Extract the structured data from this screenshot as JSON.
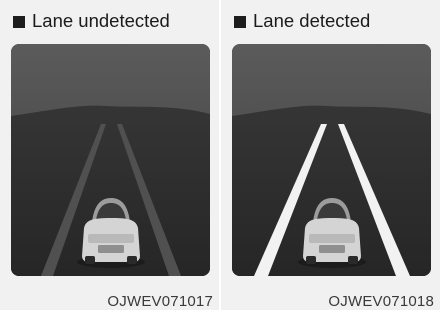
{
  "panels": [
    {
      "id": "undetected",
      "title": "Lane undetected",
      "code": "OJWEV071017",
      "lane_state": "undetected",
      "lane_color": "#4f4f4f"
    },
    {
      "id": "detected",
      "title": "Lane detected",
      "code": "OJWEV071018",
      "lane_state": "detected",
      "lane_color": "#f2f2f2"
    }
  ],
  "colors": {
    "bullet": "#1d1d1d",
    "screen_sky_top": "#5a5a5a",
    "screen_sky_bottom": "#3e3e3e",
    "screen_road": "#2e2e2e"
  },
  "icons": [
    "bullet-square-icon",
    "vehicle-icon",
    "lane-line-icon"
  ]
}
